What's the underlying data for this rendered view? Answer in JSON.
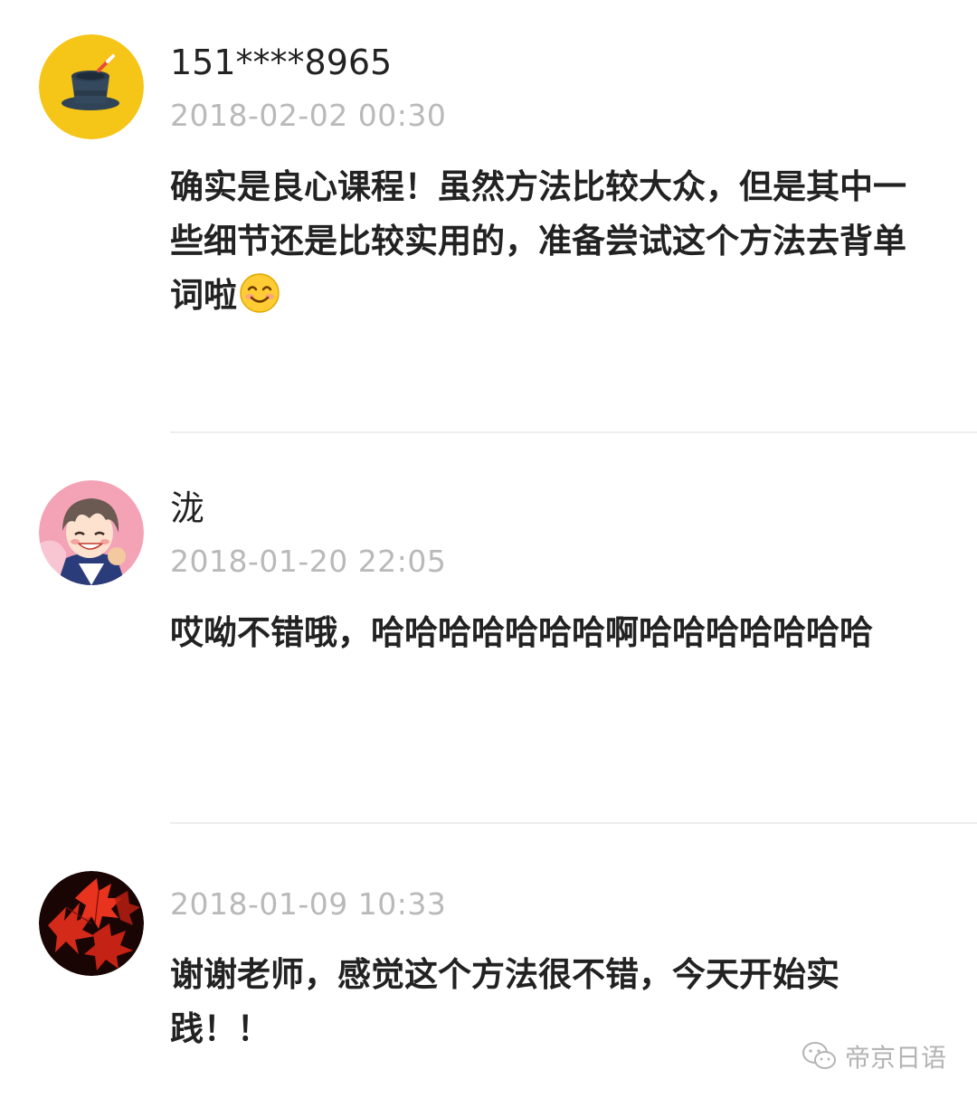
{
  "comments": [
    {
      "avatar_icon": "magic-hat-icon",
      "username": "151****8965",
      "timestamp": "2018-02-02 00:30",
      "content": "确实是良心课程！虽然方法比较大众，但是其中一些细节还是比较实用的，准备尝试这个方法去背单词啦",
      "emoji_icon": "smiling-face-emoji"
    },
    {
      "avatar_icon": "anime-character-avatar",
      "username": "泷",
      "timestamp": "2018-01-20 22:05",
      "content": "哎呦不错哦，哈哈哈哈哈哈哈啊哈哈哈哈哈哈哈"
    },
    {
      "avatar_icon": "red-maple-leaves-avatar",
      "username": "",
      "timestamp": "2018-01-09 10:33",
      "content": "谢谢老师，感觉这个方法很不错，今天开始实践！！"
    }
  ],
  "watermark": {
    "icon": "wechat-icon",
    "text": "帝京日语"
  },
  "colors": {
    "text_primary": "#222222",
    "text_secondary": "#b9b9b9",
    "divider": "#eeeeee",
    "avatar_yellow": "#f5c518"
  }
}
